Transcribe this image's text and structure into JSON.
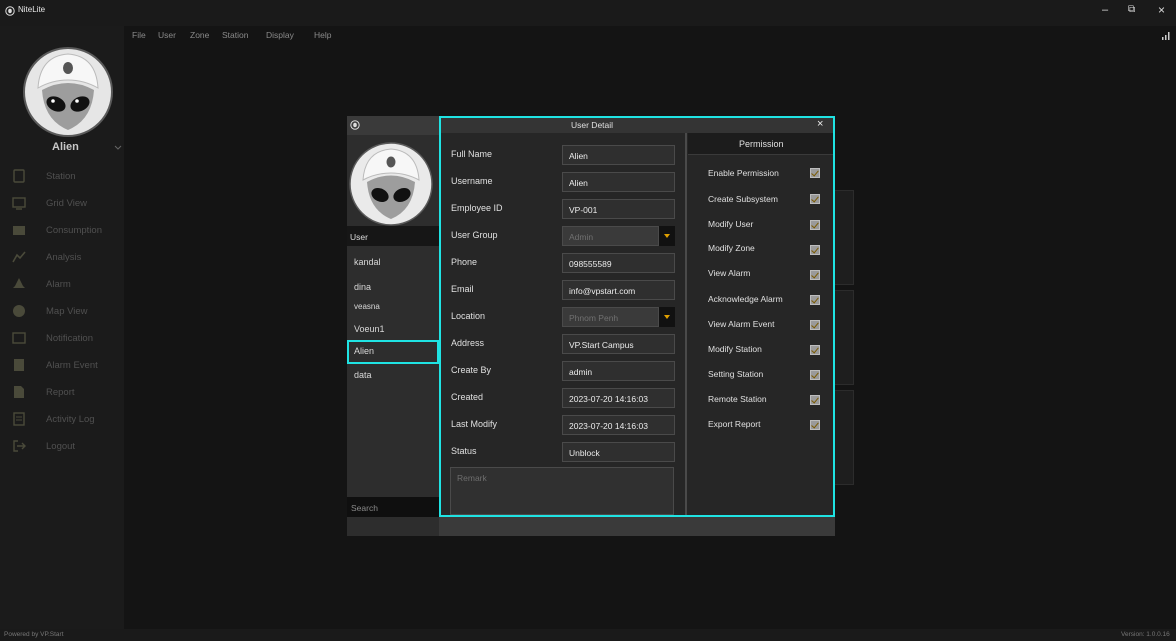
{
  "window": {
    "title": "NiteLite",
    "controls": {
      "minimize": "–",
      "restore": "⧉",
      "close": "×"
    }
  },
  "menu": [
    "File",
    "User",
    "Zone",
    "Station",
    "Display",
    "Help"
  ],
  "sidebar": {
    "username": "Alien",
    "items": [
      {
        "label": "Station",
        "icon": "station-icon"
      },
      {
        "label": "Grid View",
        "icon": "grid-view-icon"
      },
      {
        "label": "Consumption",
        "icon": "consumption-icon"
      },
      {
        "label": "Analysis",
        "icon": "analysis-icon"
      },
      {
        "label": "Alarm",
        "icon": "alarm-icon"
      },
      {
        "label": "Map View",
        "icon": "map-icon"
      },
      {
        "label": "Notification",
        "icon": "notification-icon"
      },
      {
        "label": "Alarm Event",
        "icon": "alarm-event-icon"
      },
      {
        "label": "Report",
        "icon": "report-icon"
      },
      {
        "label": "Activity Log",
        "icon": "activity-log-icon"
      },
      {
        "label": "Logout",
        "icon": "logout-icon"
      }
    ]
  },
  "user_list": {
    "header": "User",
    "users": [
      "kandal",
      "dina",
      "veasna",
      "Voeun1",
      "Alien",
      "data"
    ],
    "selected": "Alien",
    "search_placeholder": "Search"
  },
  "user_detail": {
    "title": "User Detail",
    "close": "×",
    "fields": [
      {
        "label": "Full Name",
        "value": "Alien"
      },
      {
        "label": "Username",
        "value": "Alien"
      },
      {
        "label": "Employee ID",
        "value": "VP-001"
      },
      {
        "label": "User Group",
        "value": "Admin",
        "dropdown": true
      },
      {
        "label": "Phone",
        "value": "098555589"
      },
      {
        "label": "Email",
        "value": "info@vpstart.com"
      },
      {
        "label": "Location",
        "value": "Phnom Penh",
        "dropdown": true
      },
      {
        "label": "Address",
        "value": "VP.Start Campus"
      },
      {
        "label": "Create By",
        "value": "admin"
      },
      {
        "label": "Created",
        "value": "2023-07-20 14:16:03"
      },
      {
        "label": "Last Modify",
        "value": "2023-07-20 14:16:03"
      },
      {
        "label": "Status",
        "value": "Unblock"
      }
    ],
    "remark_placeholder": "Remark"
  },
  "permission": {
    "title": "Permission",
    "items": [
      {
        "label": "Enable Permission",
        "checked": true
      },
      {
        "label": "Create Subsystem",
        "checked": true
      },
      {
        "label": "Modify User",
        "checked": true
      },
      {
        "label": "Modify Zone",
        "checked": true
      },
      {
        "label": "View Alarm",
        "checked": true
      },
      {
        "label": "Acknowledge Alarm",
        "checked": true
      },
      {
        "label": "View Alarm Event",
        "checked": true
      },
      {
        "label": "Modify Station",
        "checked": true
      },
      {
        "label": "Setting Station",
        "checked": true
      },
      {
        "label": "Remote Station",
        "checked": true
      },
      {
        "label": "Export Report",
        "checked": true
      }
    ]
  },
  "footer": {
    "powered_by": "Powered by VP.Start",
    "version": "Version: 1.0.0.16"
  },
  "colors": {
    "accent": "#1fe3e3",
    "check": "#e0a000"
  }
}
